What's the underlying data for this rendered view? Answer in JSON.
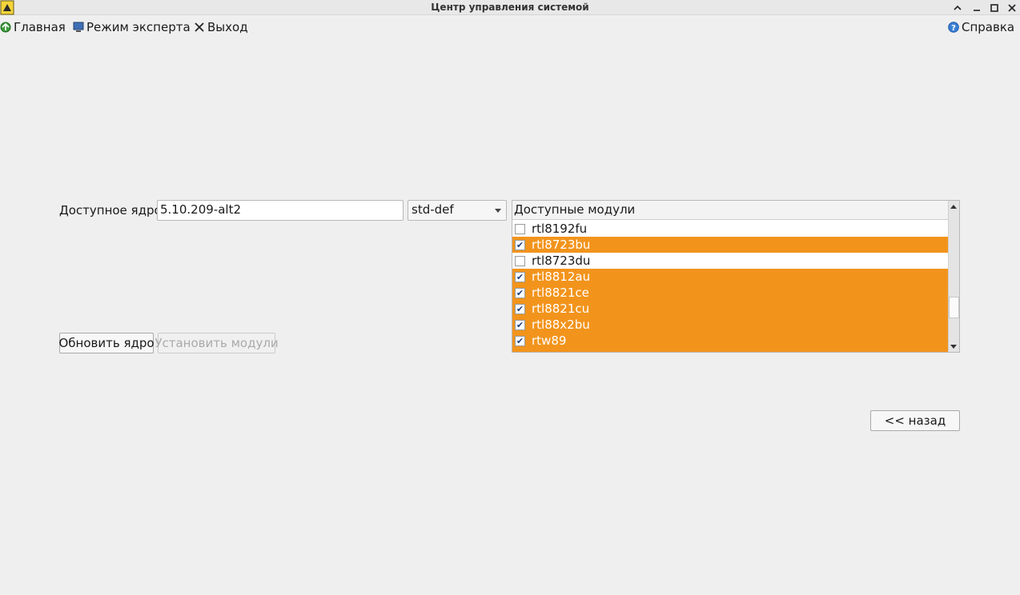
{
  "window": {
    "title": "Центр управления системой",
    "controls": [
      "chevron-up-icon",
      "minimize-icon",
      "maximize-icon",
      "close-icon"
    ]
  },
  "menu": {
    "home": {
      "label": "Главная",
      "icon": "home-icon"
    },
    "expert": {
      "label": "Режим эксперта",
      "icon": "monitor-icon"
    },
    "exit": {
      "label": "Выход",
      "icon": "close-icon"
    },
    "help": {
      "label": "Справка",
      "icon": "help-icon"
    }
  },
  "kernel": {
    "label": "Доступное ядро:",
    "version": "5.10.209-alt2",
    "flavour": "std-def"
  },
  "modules": {
    "header": "Доступные модули",
    "items": [
      {
        "name": "rtl8192fu",
        "checked": false,
        "selected": false
      },
      {
        "name": "rtl8723bu",
        "checked": true,
        "selected": true
      },
      {
        "name": "rtl8723du",
        "checked": false,
        "selected": false
      },
      {
        "name": "rtl8812au",
        "checked": true,
        "selected": true
      },
      {
        "name": "rtl8821ce",
        "checked": true,
        "selected": true
      },
      {
        "name": "rtl8821cu",
        "checked": true,
        "selected": true
      },
      {
        "name": "rtl88x2bu",
        "checked": true,
        "selected": true
      },
      {
        "name": "rtw89",
        "checked": true,
        "selected": true
      },
      {
        "name": "...",
        "checked": true,
        "selected": true
      }
    ]
  },
  "buttons": {
    "update_kernel": "Обновить ядро",
    "install_modules": "Установить модули",
    "back": "<<  назад"
  },
  "colors": {
    "selection": "#f2941c",
    "background": "#efefef"
  }
}
